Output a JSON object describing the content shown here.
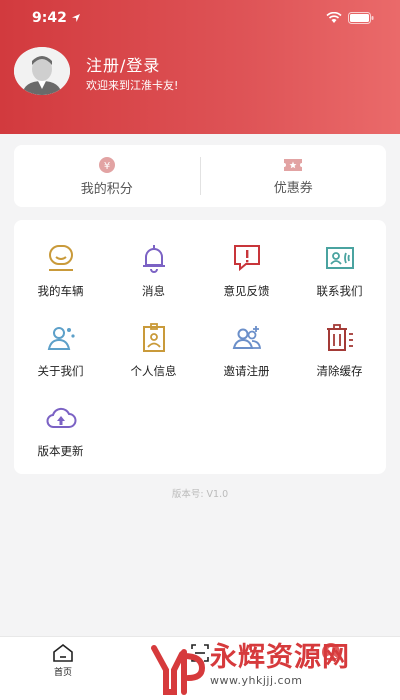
{
  "status": {
    "time": "9:42"
  },
  "profile": {
    "title": "注册/登录",
    "subtitle": "欢迎来到江淮卡友!"
  },
  "points": [
    {
      "label": "我的积分",
      "icon": "yen-coin-icon"
    },
    {
      "label": "优惠券",
      "icon": "coupon-icon"
    }
  ],
  "menu": [
    {
      "label": "我的车辆",
      "icon": "vehicle-icon"
    },
    {
      "label": "消息",
      "icon": "bell-icon"
    },
    {
      "label": "意见反馈",
      "icon": "feedback-icon"
    },
    {
      "label": "联系我们",
      "icon": "contact-card-icon"
    },
    {
      "label": "关于我们",
      "icon": "about-people-icon"
    },
    {
      "label": "个人信息",
      "icon": "badge-icon"
    },
    {
      "label": "邀请注册",
      "icon": "invite-icon"
    },
    {
      "label": "清除缓存",
      "icon": "trash-icon"
    },
    {
      "label": "版本更新",
      "icon": "cloud-upload-icon"
    }
  ],
  "version_text": "版本号: V1.0",
  "tabbar": {
    "home_label": "首页"
  },
  "watermark": {
    "title": "永辉资源网",
    "url": "www.yhkjjj.com"
  },
  "colors": {
    "brand": "#d23a3e",
    "icon_gold": "#c99a3a",
    "icon_purple": "#7b62c4",
    "icon_red": "#c8353a",
    "icon_teal": "#4aa3a0",
    "icon_blue": "#6b8fc9"
  }
}
